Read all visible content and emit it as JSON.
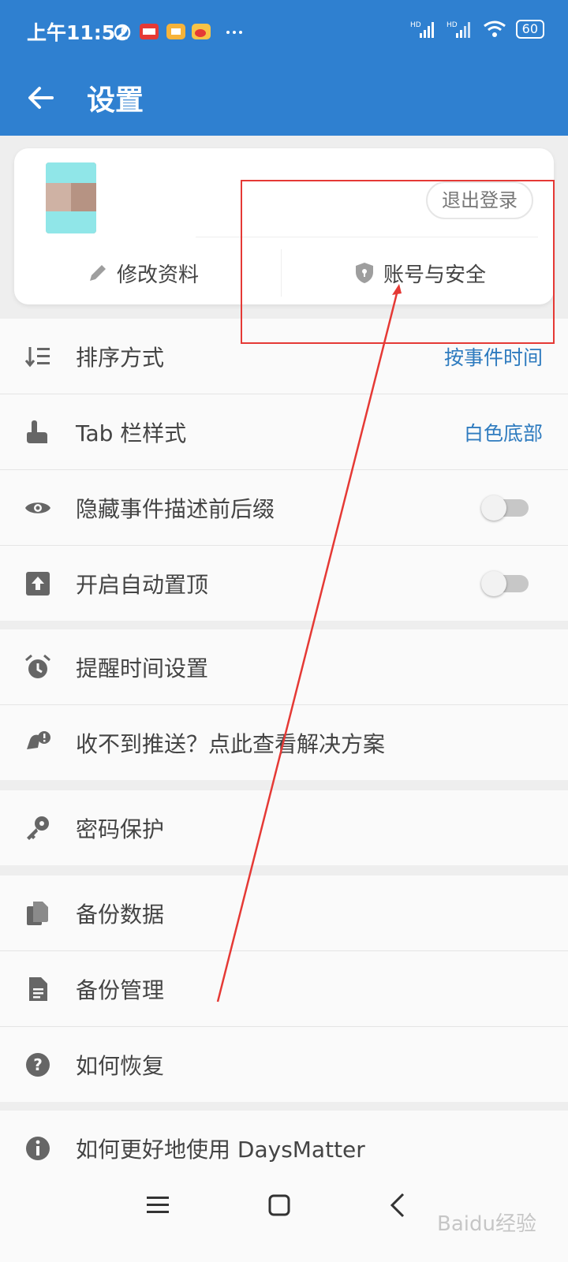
{
  "status_bar": {
    "time": "上午11:52",
    "battery": "60",
    "icons": [
      "alarm-icon",
      "toutiao-app-icon",
      "note-app-icon",
      "weibo-app-icon",
      "more-dots-icon",
      "hd-signal-icon",
      "hd-signal-icon",
      "wifi-icon",
      "battery-icon"
    ]
  },
  "app_bar": {
    "title": "设置"
  },
  "account_card": {
    "logout_label": "退出登录",
    "edit_profile_label": "修改资料",
    "account_security_label": "账号与安全"
  },
  "settings": {
    "sort": {
      "label": "排序方式",
      "value": "按事件时间"
    },
    "tab_style": {
      "label": "Tab 栏样式",
      "value": "白色底部"
    },
    "hide_suffix": {
      "label": "隐藏事件描述前后缀",
      "enabled": false
    },
    "auto_top": {
      "label": "开启自动置顶",
      "enabled": false
    },
    "remind_time": {
      "label": "提醒时间设置"
    },
    "push_help": {
      "label": "收不到推送？点此查看解决方案"
    },
    "password": {
      "label": "密码保护"
    },
    "backup_data": {
      "label": "备份数据"
    },
    "backup_manage": {
      "label": "备份管理"
    },
    "restore_help": {
      "label": "如何恢复"
    },
    "usage_help": {
      "label": "如何更好地使用 DaysMatter"
    }
  },
  "watermark": "Baidu经验",
  "colors": {
    "primary": "#2f80d0",
    "accent_text": "#2e7bbf",
    "annotation": "#e53935"
  }
}
